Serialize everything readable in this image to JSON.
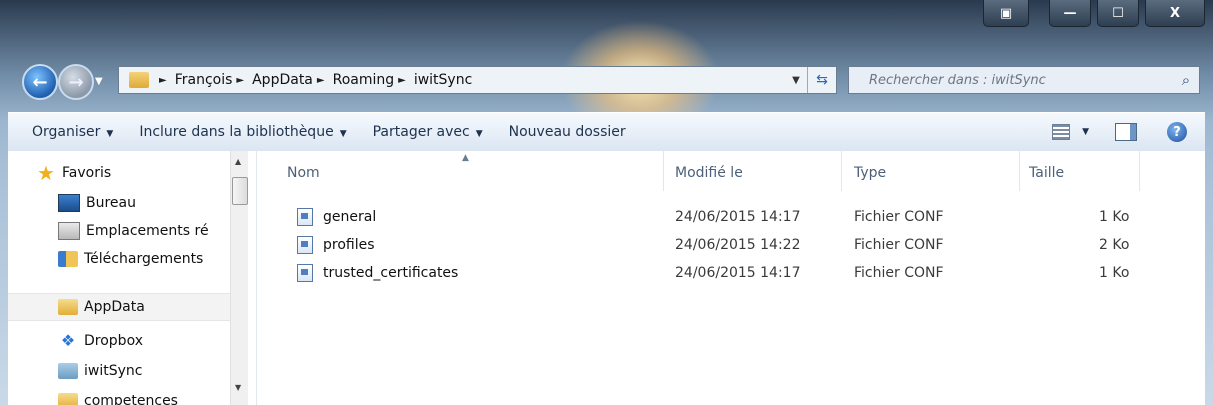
{
  "window": {
    "controls": {
      "snap_icon": "window-snap-icon",
      "minimize": "—",
      "maximize": "☐",
      "close": "X"
    }
  },
  "nav": {
    "back_icon": "back-arrow-icon",
    "forward_icon": "forward-arrow-icon",
    "breadcrumb": [
      "François",
      "AppData",
      "Roaming",
      "iwitSync"
    ],
    "refresh_icon": "refresh-icon"
  },
  "search": {
    "placeholder": "Rechercher dans : iwitSync",
    "icon": "search-icon"
  },
  "toolbar": {
    "organize": "Organiser",
    "include_library": "Inclure dans la bibliothèque",
    "share_with": "Partager avec",
    "new_folder": "Nouveau dossier",
    "help": "?"
  },
  "sidebar": {
    "items": [
      {
        "label": "Favoris",
        "icon": "star-icon"
      },
      {
        "label": "Bureau",
        "icon": "desktop-icon"
      },
      {
        "label": "Emplacements ré",
        "icon": "recent-places-icon"
      },
      {
        "label": "Téléchargements",
        "icon": "downloads-folder-icon"
      },
      {
        "label": "AppData",
        "icon": "folder-icon",
        "selected": true
      },
      {
        "label": "Dropbox",
        "icon": "dropbox-icon"
      },
      {
        "label": "iwitSync",
        "icon": "iwitsync-folder-icon"
      },
      {
        "label": "competences",
        "icon": "folder-icon"
      }
    ]
  },
  "columns": {
    "name": "Nom",
    "modified": "Modifié le",
    "type": "Type",
    "size": "Taille"
  },
  "files": [
    {
      "name": "general",
      "modified": "24/06/2015 14:17",
      "type": "Fichier CONF",
      "size": "1 Ko"
    },
    {
      "name": "profiles",
      "modified": "24/06/2015 14:22",
      "type": "Fichier CONF",
      "size": "2 Ko"
    },
    {
      "name": "trusted_certificates",
      "modified": "24/06/2015 14:17",
      "type": "Fichier CONF",
      "size": "1 Ko"
    }
  ]
}
